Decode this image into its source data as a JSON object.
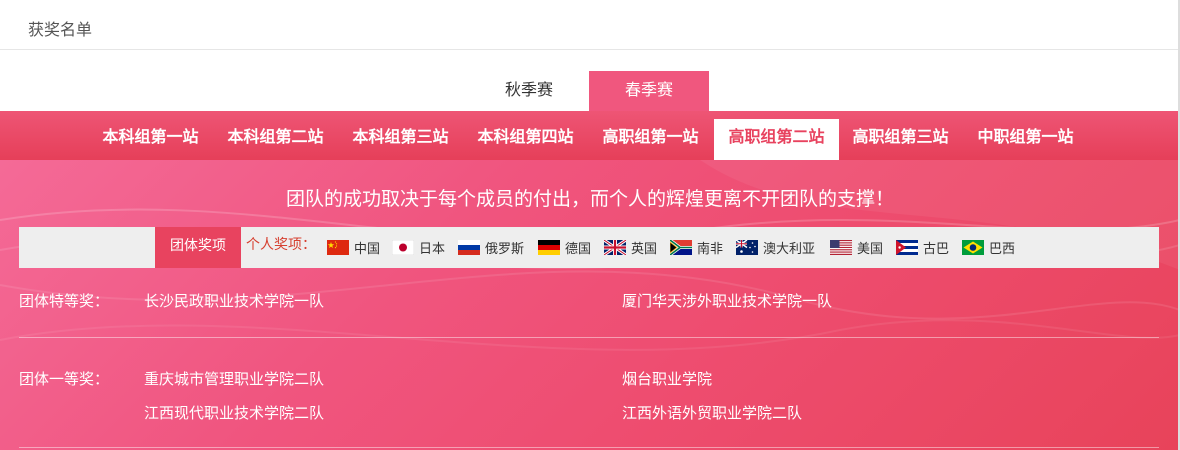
{
  "header": {
    "title": "获奖名单"
  },
  "season_tabs": [
    {
      "label": "秋季赛",
      "active": false
    },
    {
      "label": "春季赛",
      "active": true
    }
  ],
  "stage_tabs": [
    {
      "label": "本科组第一站"
    },
    {
      "label": "本科组第二站"
    },
    {
      "label": "本科组第三站"
    },
    {
      "label": "本科组第四站"
    },
    {
      "label": "高职组第一站"
    },
    {
      "label": "高职组第二站",
      "active": true
    },
    {
      "label": "高职组第三站"
    },
    {
      "label": "中职组第一站"
    }
  ],
  "slogan": "团队的成功取决于每个成员的付出，而个人的辉煌更离不开团队的支撑！",
  "award_filter": {
    "team_tab": "团体奖项",
    "individual_label": "个人奖项：",
    "countries": [
      {
        "name": "中国",
        "icon": "china-flag-icon"
      },
      {
        "name": "日本",
        "icon": "japan-flag-icon"
      },
      {
        "name": "俄罗斯",
        "icon": "russia-flag-icon"
      },
      {
        "name": "德国",
        "icon": "germany-flag-icon"
      },
      {
        "name": "英国",
        "icon": "uk-flag-icon"
      },
      {
        "name": "南非",
        "icon": "south-africa-flag-icon"
      },
      {
        "name": "澳大利亚",
        "icon": "australia-flag-icon"
      },
      {
        "name": "美国",
        "icon": "usa-flag-icon"
      },
      {
        "name": "古巴",
        "icon": "cuba-flag-icon"
      },
      {
        "name": "巴西",
        "icon": "brazil-flag-icon"
      }
    ]
  },
  "awards": [
    {
      "label": "团体特等奖：",
      "teams": [
        "长沙民政职业技术学院一队",
        "厦门华天涉外职业技术学院一队"
      ]
    },
    {
      "label": "团体一等奖：",
      "teams": [
        "重庆城市管理职业学院二队",
        "烟台职业学院",
        "江西现代职业技术学院二队",
        "江西外语外贸职业学院二队"
      ]
    }
  ],
  "colors": {
    "accent": "#e8435f",
    "tab_active": "#f0577e",
    "individual_label": "#d64030"
  }
}
